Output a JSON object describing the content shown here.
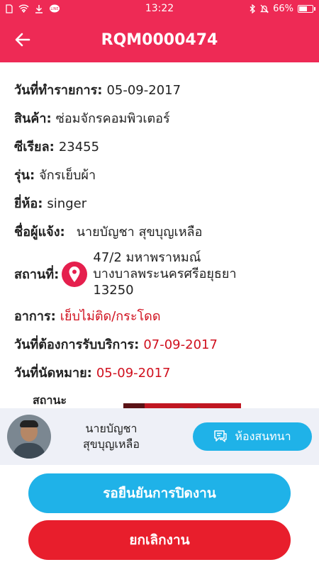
{
  "status_bar": {
    "time": "13:22",
    "battery": "66%",
    "battery_level": 0.66,
    "left_icons": [
      "sim-icon",
      "wifi-icon",
      "download-icon",
      "line-app-icon"
    ],
    "right_icons": [
      "bluetooth-icon",
      "mute-bell-icon"
    ]
  },
  "header": {
    "title": "RQM0000474",
    "back_icon": "arrow-left-icon"
  },
  "details": {
    "date_label": "วันที่ทำรายการ:",
    "date_value": "05-09-2017",
    "product_label": "สินค้า:",
    "product_value": "ซ่อมจักรคอมพิวเตอร์",
    "serial_label": "ซีเรียล:",
    "serial_value": "23455",
    "model_label": "รุ่น:",
    "model_value": "จักรเย็บผ้า",
    "brand_label": "ยี่ห้อ:",
    "brand_value": "singer",
    "reporter_label": "ชื่อผู้แจ้ง:",
    "reporter_value": "นายบัญชา สุขบุญเหลือ",
    "location_label": "สถานที่:",
    "location_line1": "47/2  มหาพราหมณ์",
    "location_line2": "บางบาลพระนครศรีอยุธยา",
    "location_line3": "13250",
    "symptom_label": "อาการ:",
    "symptom_value": "เย็บไม่ติด/กระโดด",
    "service_date_label": "วันที่ต้องการรับบริการ:",
    "service_date_value": "07-09-2017",
    "appointment_label": "วันที่นัดหมาย:",
    "appointment_value": "05-09-2017",
    "status_label": "สถานะ"
  },
  "user": {
    "name_line1": "นายบัญชา",
    "name_line2": "สุขบุญเหลือ",
    "chat_label": "ห้องสนทนา"
  },
  "actions": {
    "confirm_label": "รอยืนยันการปิดงาน",
    "cancel_label": "ยกเลิกงาน"
  },
  "colors": {
    "primary": "#ee2a55",
    "accent_blue": "#1fb2e8",
    "cancel_red": "#e81e2c",
    "highlight_red": "#d0101e"
  }
}
